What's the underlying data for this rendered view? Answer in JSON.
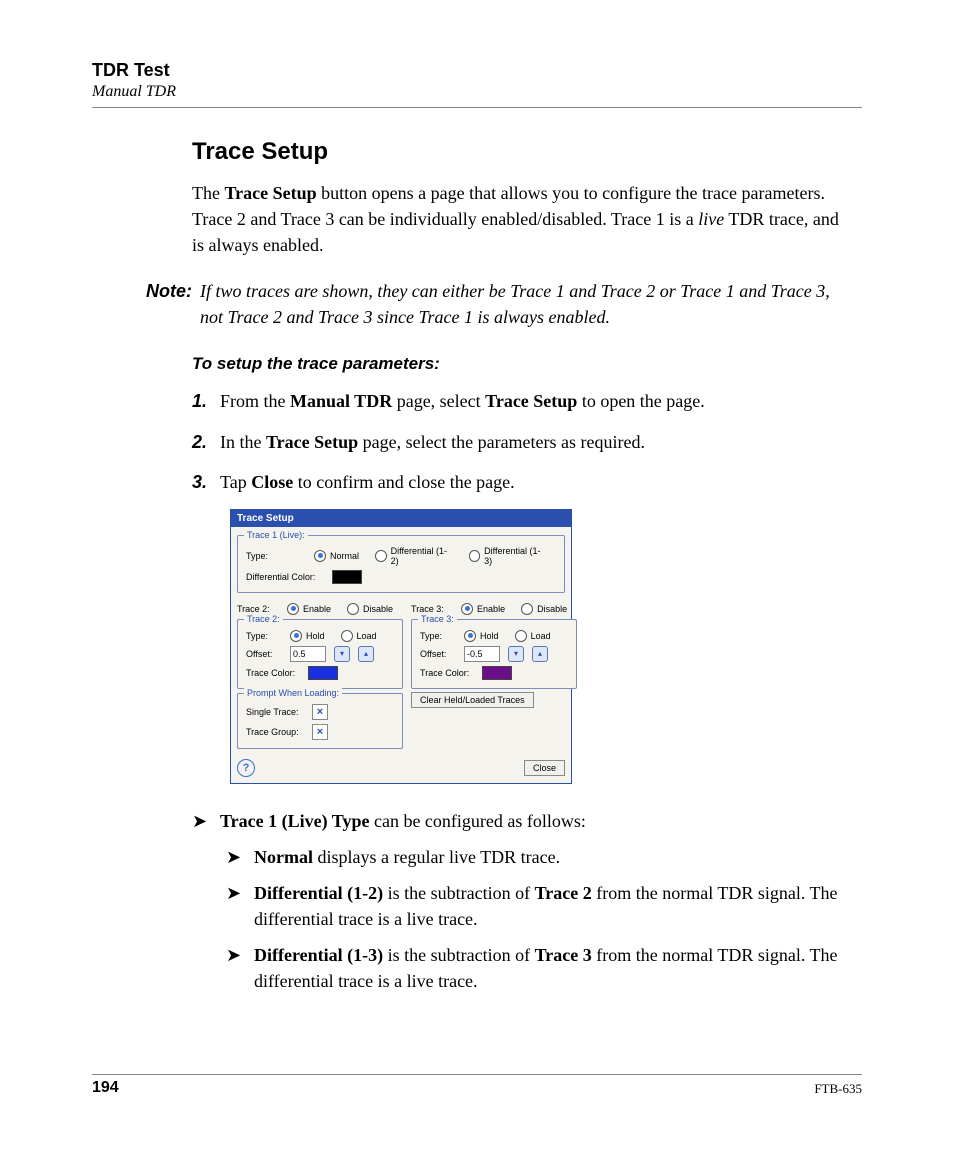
{
  "header": {
    "title": "TDR Test",
    "subtitle": "Manual TDR"
  },
  "section_title": "Trace Setup",
  "intro": {
    "pre": "The ",
    "b1": "Trace Setup",
    "mid": " button opens a page that allows you to configure the trace parameters. Trace 2 and Trace 3 can be individually enabled/disabled. Trace 1 is a ",
    "i1": "live",
    "post": " TDR trace, and is always enabled."
  },
  "note": {
    "label": "Note:",
    "text": "If two traces are shown, they can either be Trace 1 and Trace 2 or Trace 1 and Trace 3, not Trace 2 and Trace 3 since Trace 1 is always enabled."
  },
  "steps_intro": "To setup the trace parameters:",
  "steps": [
    {
      "num": "1.",
      "parts": [
        "From the ",
        "Manual TDR",
        " page, select ",
        "Trace Setup",
        " to open the page."
      ]
    },
    {
      "num": "2.",
      "parts": [
        "In the ",
        "Trace Setup",
        " page, select the parameters as required."
      ]
    },
    {
      "num": "3.",
      "parts": [
        "Tap ",
        "Close",
        " to confirm and close the page."
      ]
    }
  ],
  "dialog": {
    "title": "Trace Setup",
    "trace1": {
      "legend": "Trace 1 (Live):",
      "type_label": "Type:",
      "normal": "Normal",
      "diff12": "Differential (1-2)",
      "diff13": "Differential (1-3)",
      "diff_color_label": "Differential Color:",
      "diff_color": "#000000"
    },
    "enable": "Enable",
    "disable": "Disable",
    "t2_label": "Trace 2:",
    "t3_label": "Trace 3:",
    "trace2": {
      "legend": "Trace 2:",
      "type_label": "Type:",
      "hold": "Hold",
      "load": "Load",
      "offset_label": "Offset:",
      "offset_value": "0.5",
      "color_label": "Trace Color:",
      "color": "#1a2fe0"
    },
    "trace3": {
      "legend": "Trace 3:",
      "type_label": "Type:",
      "hold": "Hold",
      "load": "Load",
      "offset_label": "Offset:",
      "offset_value": "-0.5",
      "color_label": "Trace Color:",
      "color": "#6a0f89"
    },
    "prompt": {
      "legend": "Prompt When Loading:",
      "single": "Single Trace:",
      "group": "Trace Group:"
    },
    "clear_btn": "Clear Held/Loaded Traces",
    "close_btn": "Close"
  },
  "bullets": {
    "lead": {
      "b": "Trace 1 (Live) Type",
      "rest": " can be configured as follows:"
    },
    "items": [
      {
        "b": "Normal",
        "rest": " displays a regular live TDR trace."
      },
      {
        "b": "Differential (1-2)",
        "mid": " is the subtraction of ",
        "b2": "Trace 2",
        "rest": " from the normal TDR signal. The differential trace is a live trace."
      },
      {
        "b": "Differential (1-3)",
        "mid": " is the subtraction of ",
        "b2": "Trace 3",
        "rest": " from the normal TDR signal. The differential trace is a live trace."
      }
    ]
  },
  "footer": {
    "page": "194",
    "doc": "FTB-635"
  }
}
